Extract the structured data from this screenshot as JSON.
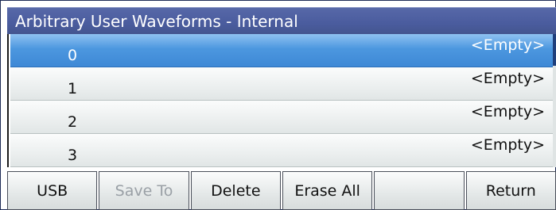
{
  "window": {
    "title": "Arbitrary User Waveforms - Internal"
  },
  "list": {
    "rows": [
      {
        "index": "0",
        "value": "<Empty>",
        "selected": true
      },
      {
        "index": "1",
        "value": "<Empty>",
        "selected": false
      },
      {
        "index": "2",
        "value": "<Empty>",
        "selected": false
      },
      {
        "index": "3",
        "value": "<Empty>",
        "selected": false
      }
    ]
  },
  "softkeys": [
    {
      "label": "USB",
      "enabled": true
    },
    {
      "label": "Save To",
      "enabled": false
    },
    {
      "label": "Delete",
      "enabled": true
    },
    {
      "label": "Erase All",
      "enabled": true
    },
    {
      "label": "",
      "enabled": true
    },
    {
      "label": "Return",
      "enabled": true
    }
  ],
  "colors": {
    "title_bar": "#4a5c9e",
    "selected_row": "#4c97df",
    "disabled_text": "#9aa0a6"
  }
}
